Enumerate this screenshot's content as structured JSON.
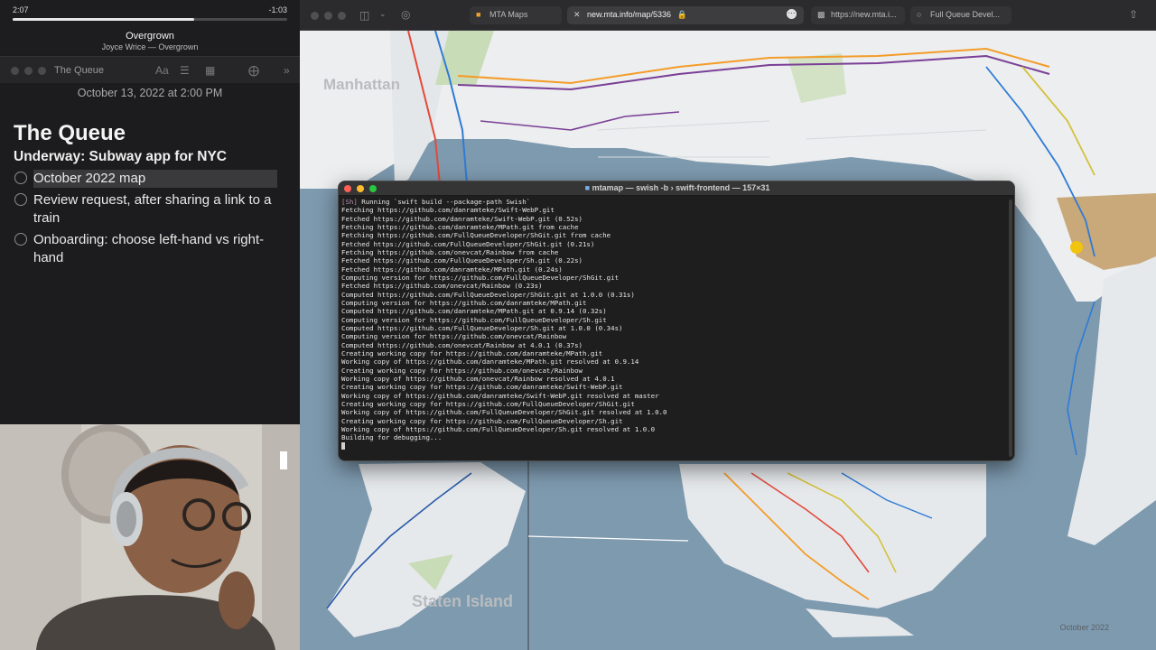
{
  "music": {
    "elapsed": "2:07",
    "remaining": "-1:03",
    "progress": 0.66,
    "title": "Overgrown",
    "artist": "Joyce Wrice — Overgrown"
  },
  "notes": {
    "app_title": "The Queue",
    "date": "October 13, 2022 at 2:00 PM",
    "title": "The Queue",
    "subtitle": "Underway: Subway app for NYC",
    "tasks": [
      {
        "text": "October 2022 map",
        "selected": true
      },
      {
        "text": "Review request, after sharing a link to a train",
        "selected": false
      },
      {
        "text": "Onboarding: choose left-hand vs right-hand",
        "selected": false
      }
    ]
  },
  "browser": {
    "tabs": [
      {
        "label": "MTA Maps",
        "icon": "mta-icon"
      },
      {
        "label": "new.mta.info/map/5336",
        "icon": "close-icon"
      },
      {
        "label": "https://new.mta.i...",
        "icon": "page-icon"
      },
      {
        "label": "Full Queue Devel...",
        "icon": "page-icon"
      }
    ]
  },
  "map": {
    "labels": {
      "manhattan": "Manhattan",
      "staten_island": "Staten Island",
      "edition": "October 2022"
    }
  },
  "terminal": {
    "title": "mtamap — swish -b › swift-frontend — 157×31",
    "prompt": "[Sh]",
    "lines": [
      "Running `swift build --package-path Swish`",
      "Fetching https://github.com/danramteke/Swift-WebP.git",
      "Fetched https://github.com/danramteke/Swift-WebP.git (0.52s)",
      "Fetching https://github.com/danramteke/MPath.git from cache",
      "Fetching https://github.com/FullQueueDeveloper/ShGit.git from cache",
      "Fetched https://github.com/FullQueueDeveloper/ShGit.git (0.21s)",
      "Fetching https://github.com/onevcat/Rainbow from cache",
      "Fetched https://github.com/FullQueueDeveloper/Sh.git (0.22s)",
      "Fetched https://github.com/danramteke/MPath.git (0.24s)",
      "Computing version for https://github.com/FullQueueDeveloper/ShGit.git",
      "Fetched https://github.com/onevcat/Rainbow (0.23s)",
      "Computed https://github.com/FullQueueDeveloper/ShGit.git at 1.0.0 (0.31s)",
      "Computing version for https://github.com/danramteke/MPath.git",
      "Computed https://github.com/danramteke/MPath.git at 0.9.14 (0.32s)",
      "Computing version for https://github.com/FullQueueDeveloper/Sh.git",
      "Computed https://github.com/FullQueueDeveloper/Sh.git at 1.0.0 (0.34s)",
      "Computing version for https://github.com/onevcat/Rainbow",
      "Computed https://github.com/onevcat/Rainbow at 4.0.1 (0.37s)",
      "Creating working copy for https://github.com/danramteke/MPath.git",
      "Working copy of https://github.com/danramteke/MPath.git resolved at 0.9.14",
      "Creating working copy for https://github.com/onevcat/Rainbow",
      "Working copy of https://github.com/onevcat/Rainbow resolved at 4.0.1",
      "Creating working copy for https://github.com/danramteke/Swift-WebP.git",
      "Working copy of https://github.com/danramteke/Swift-WebP.git resolved at master",
      "Creating working copy for https://github.com/FullQueueDeveloper/ShGit.git",
      "Working copy of https://github.com/FullQueueDeveloper/ShGit.git resolved at 1.0.0",
      "Creating working copy for https://github.com/FullQueueDeveloper/Sh.git",
      "Working copy of https://github.com/FullQueueDeveloper/Sh.git resolved at 1.0.0",
      "Building for debugging..."
    ]
  },
  "colors": {
    "water": "#7e9aaf",
    "land": "#eceeef",
    "park": "#c9dcb8",
    "airport": "#c9a87a",
    "selection": "#3a3a3c"
  }
}
